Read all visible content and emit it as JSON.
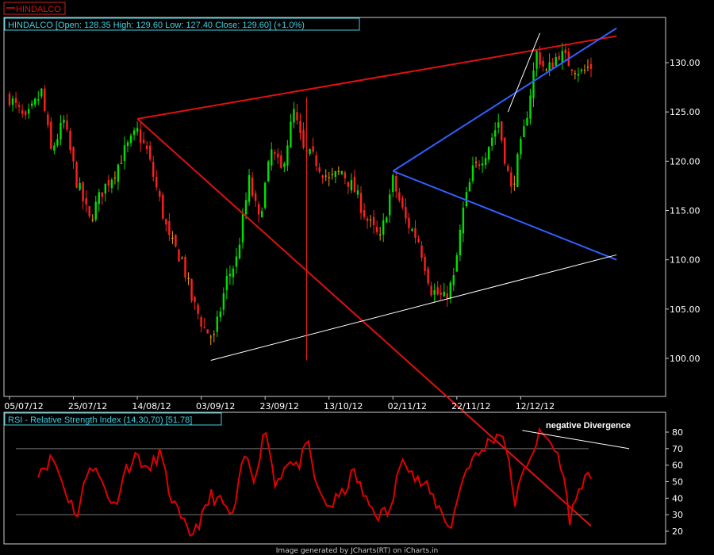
{
  "symbol_tag": "HINDALCO",
  "footer": "Image generated by  JCharts(RT) on iCharts.in",
  "colors": {
    "background": "#000000",
    "frame": "#cccccc",
    "label_text": "#40d0e0",
    "candle_up": "#00e000",
    "candle_down": "#ff2020",
    "candle_flat": "#f0a000",
    "red_trend": "#e01010",
    "blue_trend": "#3060ff",
    "white_trend": "#ffffff",
    "rsi_line": "#e00000",
    "rsi_band": "#777777"
  },
  "chart_data": [
    {
      "type": "candlestick",
      "title": "HINDALCO [Open: 128.35  High: 129.60  Low: 127.40  Close: 129.60] (+1.0%)",
      "x_ticks": [
        "05/07/12",
        "25/07/12",
        "14/08/12",
        "03/09/12",
        "23/09/12",
        "13/10/12",
        "02/11/12",
        "22/11/12",
        "12/12/12"
      ],
      "x_range": [
        "2012-07-05",
        "2013-01-03"
      ],
      "y_ticks": [
        "100.00",
        "105.00",
        "110.00",
        "115.00",
        "120.00",
        "125.00",
        "130.00"
      ],
      "ylim": [
        96.3,
        133.5
      ],
      "grid": false,
      "series": {
        "date": [
          "2012-07-05",
          "2012-07-10",
          "2012-07-15",
          "2012-07-18",
          "2012-07-22",
          "2012-07-26",
          "2012-07-30",
          "2012-08-03",
          "2012-08-07",
          "2012-08-10",
          "2012-08-14",
          "2012-08-17",
          "2012-08-21",
          "2012-08-24",
          "2012-08-28",
          "2012-08-31",
          "2012-09-04",
          "2012-09-07",
          "2012-09-11",
          "2012-09-14",
          "2012-09-18",
          "2012-09-21",
          "2012-09-25",
          "2012-09-28",
          "2012-10-02",
          "2012-10-05",
          "2012-10-09",
          "2012-10-13",
          "2012-10-17",
          "2012-10-21",
          "2012-10-25",
          "2012-10-29",
          "2012-11-02",
          "2012-11-06",
          "2012-11-10",
          "2012-11-14",
          "2012-11-18",
          "2012-11-21",
          "2012-11-24",
          "2012-11-27",
          "2012-12-01",
          "2012-12-05",
          "2012-12-09",
          "2012-12-13",
          "2012-12-17",
          "2012-12-20",
          "2012-12-24",
          "2012-12-27",
          "2012-12-31",
          "2013-01-03"
        ],
        "close": [
          126.5,
          124.0,
          127.0,
          121.0,
          124.0,
          118.0,
          114.0,
          117.0,
          119.0,
          121.0,
          123.0,
          121.0,
          116.0,
          112.0,
          110.0,
          106.0,
          103.0,
          102.0,
          108.0,
          110.0,
          118.0,
          114.0,
          121.0,
          119.0,
          125.0,
          121.0,
          120.0,
          118.0,
          119.0,
          117.0,
          114.0,
          112.0,
          118.0,
          114.0,
          112.0,
          107.0,
          106.0,
          108.0,
          115.0,
          119.0,
          121.0,
          124.0,
          117.0,
          123.0,
          131.0,
          129.0,
          131.0,
          130.0,
          129.0,
          129.6
        ]
      }
    },
    {
      "type": "line",
      "title": "RSI - Relative Strength Index (14,30,70) [51.78]",
      "y_ticks": [
        "20",
        "30",
        "40",
        "50",
        "60",
        "70",
        "80"
      ],
      "ylim": [
        14,
        84
      ],
      "band": [
        30,
        70
      ],
      "annotation": "negative Divergence",
      "series": {
        "date": [
          "2012-07-05",
          "2012-07-10",
          "2012-07-15",
          "2012-07-18",
          "2012-07-22",
          "2012-07-26",
          "2012-07-30",
          "2012-08-03",
          "2012-08-07",
          "2012-08-10",
          "2012-08-14",
          "2012-08-17",
          "2012-08-21",
          "2012-08-24",
          "2012-08-28",
          "2012-08-31",
          "2012-09-04",
          "2012-09-07",
          "2012-09-11",
          "2012-09-14",
          "2012-09-18",
          "2012-09-21",
          "2012-09-25",
          "2012-09-28",
          "2012-10-02",
          "2012-10-05",
          "2012-10-09",
          "2012-10-13",
          "2012-10-17",
          "2012-10-21",
          "2012-10-25",
          "2012-10-29",
          "2012-11-02",
          "2012-11-06",
          "2012-11-10",
          "2012-11-14",
          "2012-11-18",
          "2012-11-21",
          "2012-11-24",
          "2012-11-27",
          "2012-12-01",
          "2012-12-05",
          "2012-12-09",
          "2012-12-13",
          "2012-12-17",
          "2012-12-20",
          "2012-12-24",
          "2012-12-27",
          "2012-12-31",
          "2013-01-03"
        ],
        "value": [
          57,
          64,
          40,
          30,
          62,
          50,
          35,
          58,
          66,
          55,
          68,
          45,
          26,
          18,
          28,
          42,
          36,
          28,
          66,
          52,
          83,
          48,
          63,
          58,
          72,
          44,
          35,
          42,
          56,
          38,
          30,
          32,
          68,
          52,
          46,
          34,
          22,
          48,
          62,
          66,
          76,
          80,
          38,
          62,
          78,
          76,
          62,
          28,
          50,
          51.8
        ]
      }
    }
  ],
  "trendlines": [
    {
      "color_key": "red_trend",
      "from": [
        "2012-08-14",
        124.3
      ],
      "to": [
        "2013-01-11",
        132.7
      ]
    },
    {
      "color_key": "red_trend",
      "from": [
        "2012-08-14",
        124.3
      ],
      "to": [
        "2013-01-03",
        83.0
      ]
    },
    {
      "color_key": "blue_trend",
      "from": [
        "2012-11-02",
        119.0
      ],
      "to": [
        "2013-01-11",
        133.5
      ]
    },
    {
      "color_key": "blue_trend",
      "from": [
        "2012-11-02",
        119.0
      ],
      "to": [
        "2013-01-11",
        110.0
      ]
    },
    {
      "color_key": "white_trend",
      "from": [
        "2012-09-06",
        99.8
      ],
      "to": [
        "2013-01-11",
        110.5
      ]
    },
    {
      "color_key": "white_trend",
      "from": [
        "2012-12-08",
        125.0
      ],
      "to": [
        "2012-12-18",
        133.0
      ]
    },
    {
      "color_key": "candle_down",
      "from": [
        "2012-10-06",
        99.8
      ],
      "to": [
        "2012-10-06",
        126.5
      ]
    }
  ],
  "rsi_divergence_line": {
    "from": [
      "2012-12-10",
      81
    ],
    "to": [
      "2013-01-05",
      70
    ]
  }
}
